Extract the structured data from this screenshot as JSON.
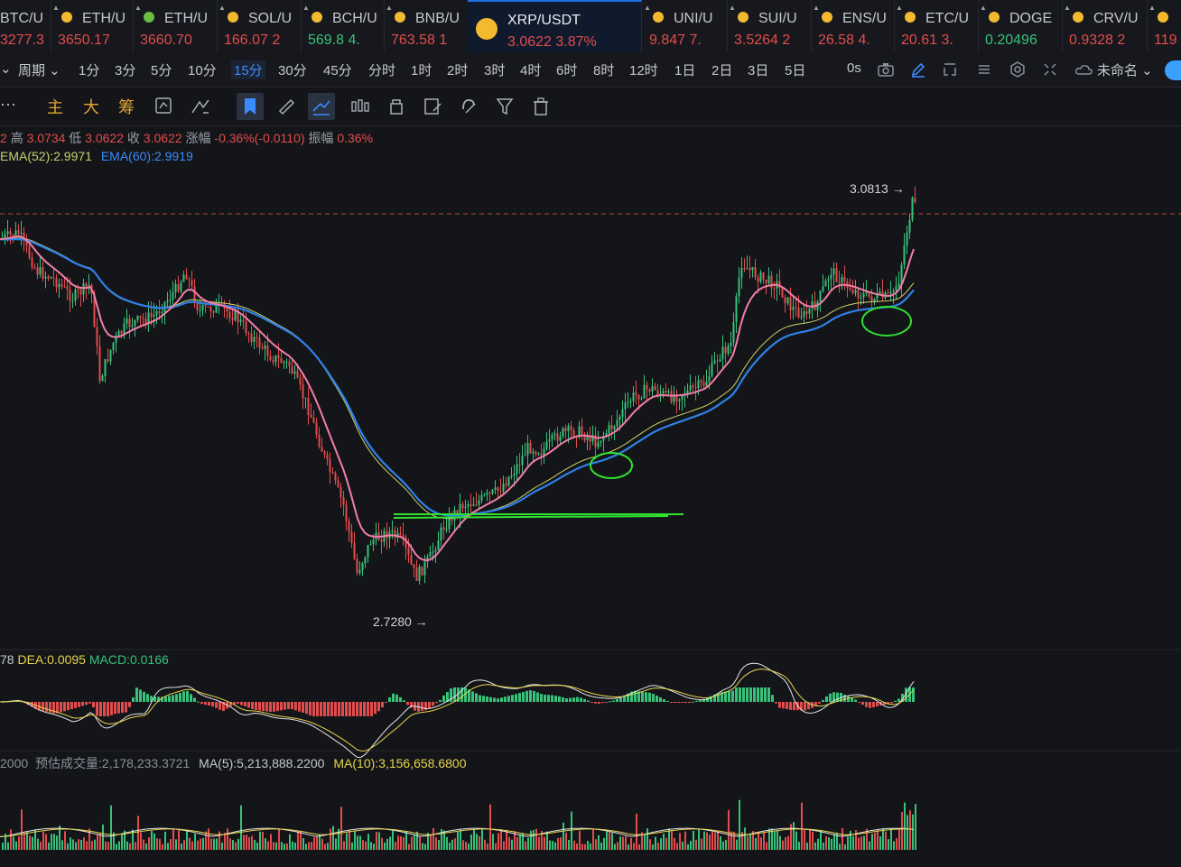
{
  "tickers": [
    {
      "symbol": "BTC/U",
      "price": "3277.3",
      "dir": "neg"
    },
    {
      "symbol": "ETH/U",
      "price": "3650.17",
      "dir": "neg"
    },
    {
      "symbol": "ETH/U",
      "price": "3660.70",
      "dir": "neg"
    },
    {
      "symbol": "SOL/U",
      "price": "166.07 2",
      "dir": "neg"
    },
    {
      "symbol": "BCH/U",
      "price": "569.8 4.",
      "dir": "pos"
    },
    {
      "symbol": "BNB/U",
      "price": "763.58 1",
      "dir": "neg"
    },
    {
      "symbol": "XRP/USDT",
      "price": "3.0622 3.87%",
      "dir": "neg",
      "active": true
    },
    {
      "symbol": "UNI/U",
      "price": "9.847 7.",
      "dir": "neg"
    },
    {
      "symbol": "SUI/U",
      "price": "3.5264 2",
      "dir": "neg"
    },
    {
      "symbol": "ENS/U",
      "price": "26.58 4.",
      "dir": "neg"
    },
    {
      "symbol": "ETC/U",
      "price": "20.61 3.",
      "dir": "neg"
    },
    {
      "symbol": "DOGE",
      "price": "0.20496",
      "dir": "pos"
    },
    {
      "symbol": "CRV/U",
      "price": "0.9328 2",
      "dir": "neg"
    },
    {
      "symbol": "",
      "price": "119",
      "dir": "neg"
    }
  ],
  "toolbar": {
    "period_label": "周期",
    "intervals": [
      "1分",
      "3分",
      "5分",
      "10分",
      "15分",
      "30分",
      "45分",
      "分时",
      "1时",
      "2时",
      "3时",
      "4时",
      "6时",
      "8时",
      "12时",
      "1日",
      "2日",
      "3日",
      "5日"
    ],
    "active_interval": "15分",
    "countdown": "0s",
    "layout_name": "未命名"
  },
  "toolbar2": {
    "chars": [
      "主",
      "大",
      "筹"
    ]
  },
  "ohlc": {
    "high_label": "高",
    "high": "3.0734",
    "low_label": "低",
    "low": "3.0622",
    "close_label": "收",
    "close": "3.0622",
    "change_label": "涨幅",
    "change": "-0.36%(-0.0110)",
    "amp_label": "振幅",
    "amp": "0.36%"
  },
  "ema": {
    "ema52": "EMA(52):2.9971",
    "ema60": "EMA(60):2.9919"
  },
  "price_marks": {
    "high": "3.0813 →",
    "low": "2.7280 →"
  },
  "macd": {
    "prefix": "78",
    "dea": "DEA:0.0095",
    "macd": "MACD:0.0166"
  },
  "volume": {
    "prefix": "2000",
    "forecast": "预估成交量:2,178,233.3721",
    "ma5": "MA(5):5,213,888.2200",
    "ma10": "MA(10):3,156,658.6800"
  },
  "colors": {
    "up": "#36c27a",
    "down": "#e24c4c",
    "accent": "#3a8bff",
    "ema_pink": "#f27ea9",
    "ema_yellow": "#c9d26a",
    "ema_blue": "#2f80e8",
    "annot": "#2ee22e"
  }
}
